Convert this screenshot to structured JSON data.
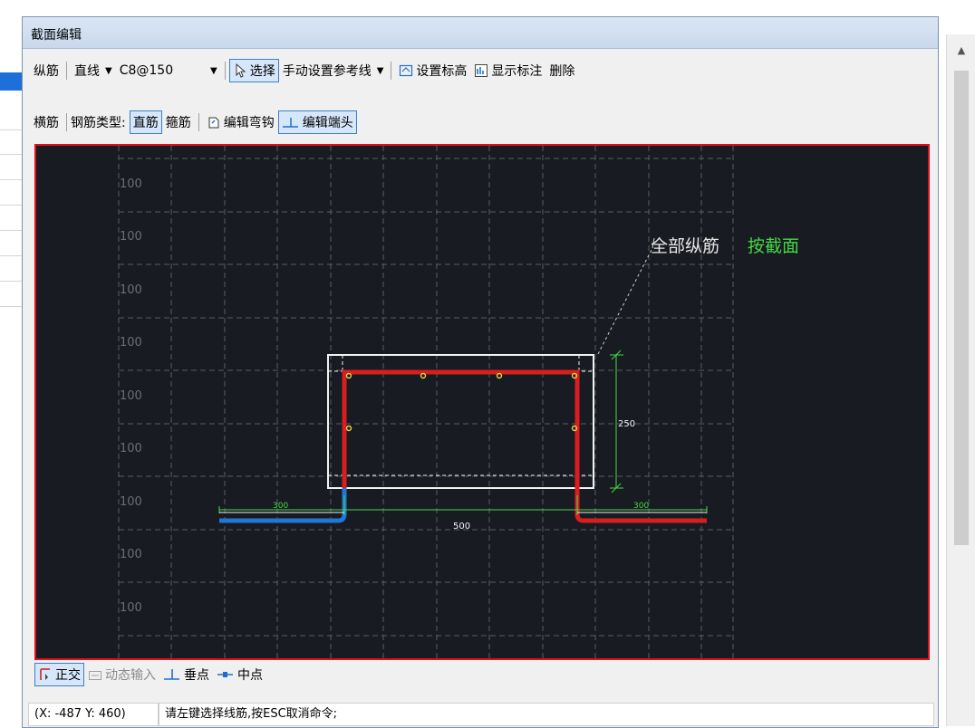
{
  "dialog": {
    "title": "截面编辑"
  },
  "toolbar1": {
    "rebar_mode": "纵筋",
    "shape": "直线",
    "rebar_spec": "C8@150",
    "select": "选择",
    "manual_ref_line": "手动设置参考线",
    "set_elevation": "设置标高",
    "show_annotation": "显示标注",
    "delete": "删除"
  },
  "toolbar2": {
    "transverse": "横筋",
    "rebar_type_label": "钢筋类型:",
    "straight": "直筋",
    "stirrup": "箍筋",
    "edit_hook": "编辑弯钩",
    "edit_end": "编辑端头"
  },
  "canvas": {
    "grid_label": "100",
    "annotation_white": "全部纵筋",
    "annotation_green": "按截面",
    "dim_height": "250",
    "dim_width": "500",
    "dim_left_ext": "300",
    "dim_right_ext": "300",
    "colors": {
      "background": "#191b22",
      "border": "#e0101a",
      "red_rebar": "#d81e1e",
      "blue_rebar": "#1e78d8",
      "green": "#45d845"
    }
  },
  "bottom_toolbar": {
    "ortho": "正交",
    "dynamic_input": "动态输入",
    "perpendicular": "垂点",
    "midpoint": "中点"
  },
  "status": {
    "coords": "(X: -487 Y: 460)",
    "message": "请左键选择线筋,按ESC取消命令;"
  }
}
